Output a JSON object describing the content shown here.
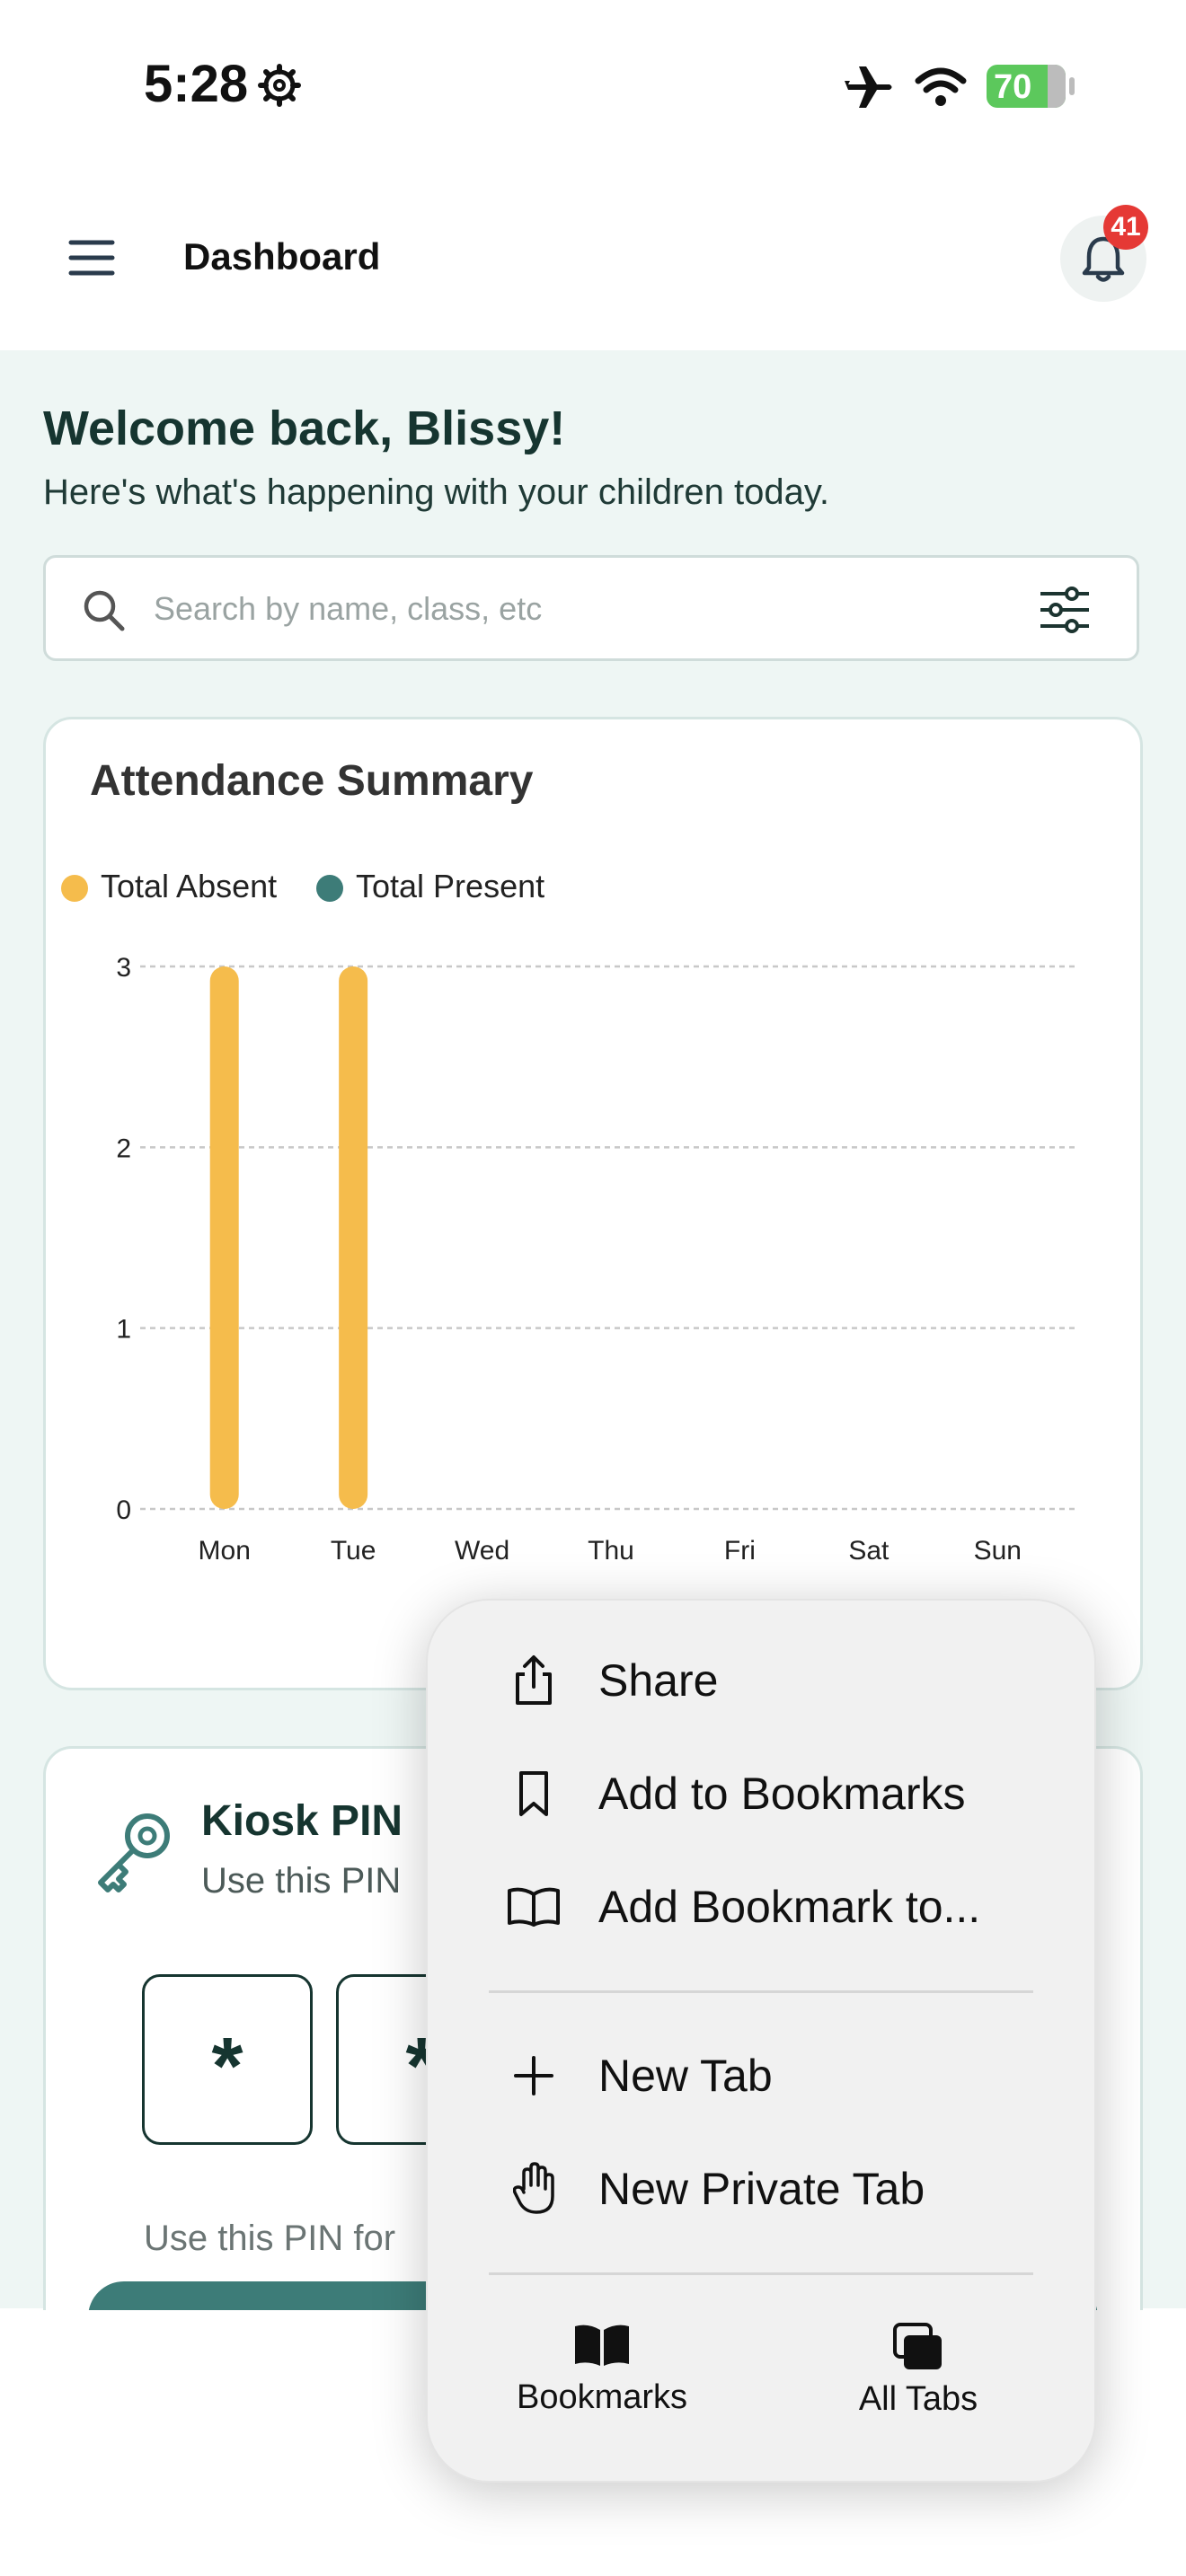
{
  "status_bar": {
    "time": "5:28",
    "battery": "70"
  },
  "header": {
    "title": "Dashboard",
    "notification_count": "41"
  },
  "welcome": {
    "heading": "Welcome back, Blissy!",
    "subtitle": "Here's what's happening with your children today."
  },
  "search": {
    "placeholder": "Search by name, class, etc"
  },
  "attendance": {
    "title": "Attendance Summary",
    "legend": [
      {
        "label": "Total Absent",
        "color": "#f5bc4c"
      },
      {
        "label": "Total Present",
        "color": "#3d7c78"
      }
    ]
  },
  "chart_data": {
    "type": "bar",
    "categories": [
      "Mon",
      "Tue",
      "Wed",
      "Thu",
      "Fri",
      "Sat",
      "Sun"
    ],
    "series": [
      {
        "name": "Total Absent",
        "values": [
          3,
          3,
          0,
          0,
          0,
          0,
          0
        ],
        "color": "#f5bc4c"
      },
      {
        "name": "Total Present",
        "values": [
          0,
          0,
          0,
          0,
          0,
          0,
          0
        ],
        "color": "#3d7c78"
      }
    ],
    "yticks": [
      "0",
      "1",
      "2",
      "3"
    ],
    "ylim": [
      0,
      3
    ],
    "grid": true,
    "legend": "top-left"
  },
  "kiosk": {
    "title": "Kiosk PIN",
    "subtitle": "Use this PIN",
    "pin": [
      "*",
      "*"
    ],
    "note": "Use this PIN for"
  },
  "menu": {
    "items": [
      {
        "label": "Share",
        "icon": "share-icon"
      },
      {
        "label": "Add to Bookmarks",
        "icon": "bookmark-icon"
      },
      {
        "label": "Add Bookmark to...",
        "icon": "book-open-icon"
      },
      {
        "label": "New Tab",
        "icon": "plus-icon"
      },
      {
        "label": "New Private Tab",
        "icon": "hand-icon"
      }
    ],
    "bottom": [
      {
        "label": "Bookmarks",
        "icon": "book-icon"
      },
      {
        "label": "All Tabs",
        "icon": "tabs-icon"
      }
    ]
  }
}
